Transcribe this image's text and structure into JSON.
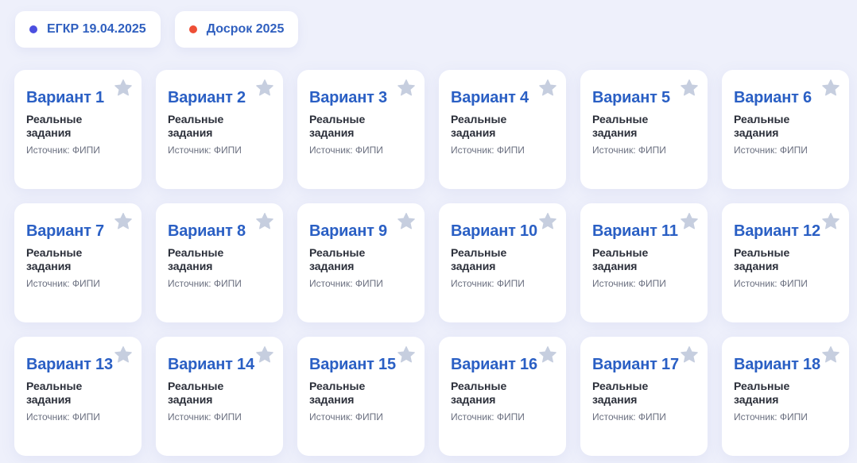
{
  "filters": [
    {
      "label": "ЕГКР 19.04.2025",
      "dot_color": "#4b4fe0"
    },
    {
      "label": "Досрок 2025",
      "dot_color": "#ee4f36"
    }
  ],
  "cards": [
    {
      "title": "Вариант 1",
      "subtitle": "Реальные задания",
      "source": "Источник: ФИПИ"
    },
    {
      "title": "Вариант 2",
      "subtitle": "Реальные задания",
      "source": "Источник: ФИПИ"
    },
    {
      "title": "Вариант 3",
      "subtitle": "Реальные задания",
      "source": "Источник: ФИПИ"
    },
    {
      "title": "Вариант 4",
      "subtitle": "Реальные задания",
      "source": "Источник: ФИПИ"
    },
    {
      "title": "Вариант 5",
      "subtitle": "Реальные задания",
      "source": "Источник: ФИПИ"
    },
    {
      "title": "Вариант 6",
      "subtitle": "Реальные задания",
      "source": "Источник: ФИПИ"
    },
    {
      "title": "Вариант 7",
      "subtitle": "Реальные задания",
      "source": "Источник: ФИПИ"
    },
    {
      "title": "Вариант 8",
      "subtitle": "Реальные задания",
      "source": "Источник: ФИПИ"
    },
    {
      "title": "Вариант 9",
      "subtitle": "Реальные задания",
      "source": "Источник: ФИПИ"
    },
    {
      "title": "Вариант 10",
      "subtitle": "Реальные задания",
      "source": "Источник: ФИПИ"
    },
    {
      "title": "Вариант 11",
      "subtitle": "Реальные задания",
      "source": "Источник: ФИПИ"
    },
    {
      "title": "Вариант 12",
      "subtitle": "Реальные задания",
      "source": "Источник: ФИПИ"
    },
    {
      "title": "Вариант 13",
      "subtitle": "Реальные задания",
      "source": "Источник: ФИПИ"
    },
    {
      "title": "Вариант 14",
      "subtitle": "Реальные задания",
      "source": "Источник: ФИПИ"
    },
    {
      "title": "Вариант 15",
      "subtitle": "Реальные задания",
      "source": "Источник: ФИПИ"
    },
    {
      "title": "Вариант 16",
      "subtitle": "Реальные задания",
      "source": "Источник: ФИПИ"
    },
    {
      "title": "Вариант 17",
      "subtitle": "Реальные задания",
      "source": "Источник: ФИПИ"
    },
    {
      "title": "Вариант 18",
      "subtitle": "Реальные задания",
      "source": "Источник: ФИПИ"
    }
  ],
  "colors": {
    "background": "#eef0fb",
    "title": "#2a5fc4",
    "star": "#c6cedf"
  },
  "icons": {
    "favorite": "star-icon"
  }
}
